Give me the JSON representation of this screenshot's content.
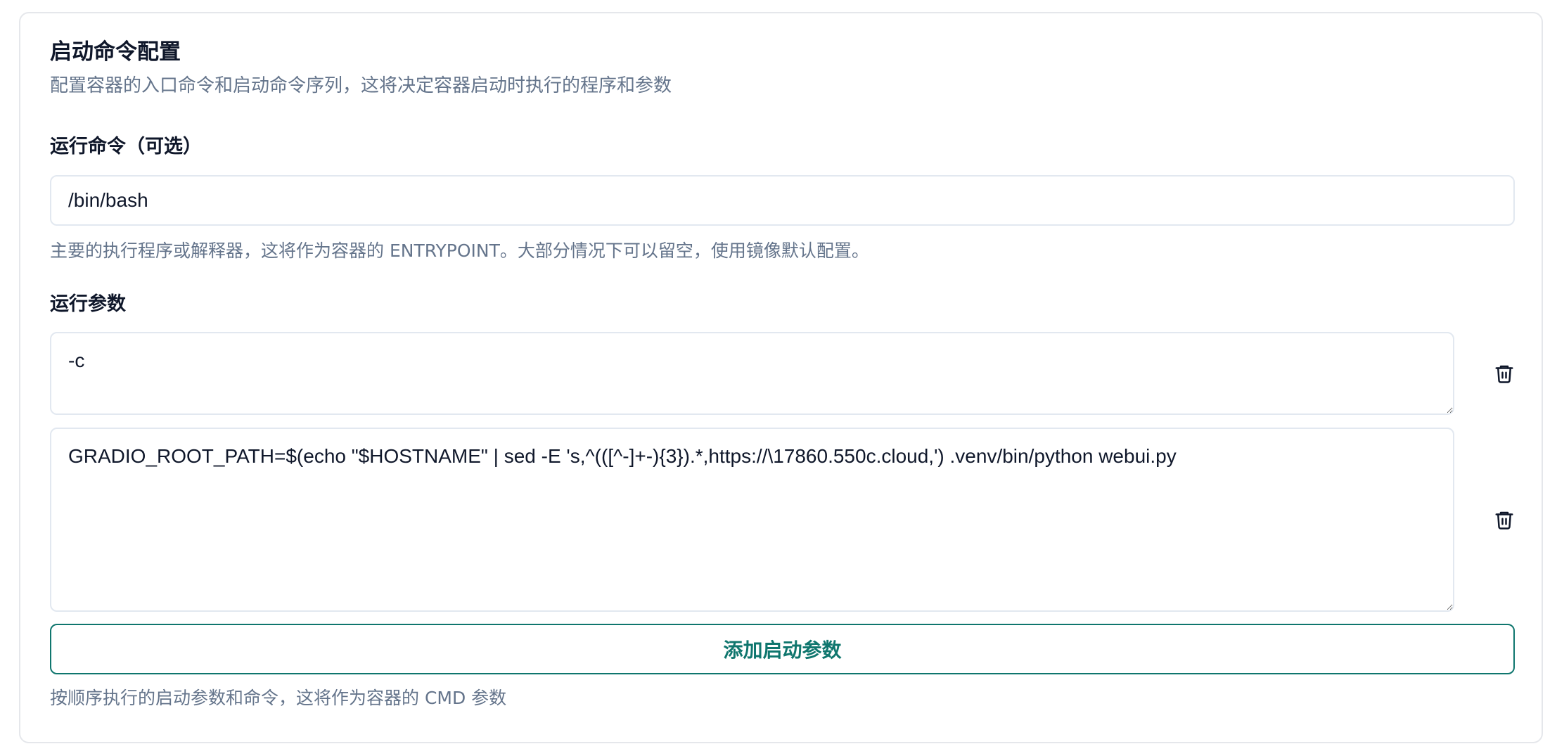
{
  "section": {
    "title": "启动命令配置",
    "description": "配置容器的入口命令和启动命令序列，这将决定容器启动时执行的程序和参数"
  },
  "command": {
    "label": "运行命令（可选）",
    "value": "/bin/bash",
    "hint": "主要的执行程序或解释器，这将作为容器的 ENTRYPOINT。大部分情况下可以留空，使用镜像默认配置。"
  },
  "args": {
    "label": "运行参数",
    "items": [
      {
        "value": "-c"
      },
      {
        "value": "GRADIO_ROOT_PATH=$(echo \"$HOSTNAME\" | sed -E 's,^(([^-]+-){3}).*,https://\\17860.550c.cloud,') .venv/bin/python webui.py"
      }
    ],
    "add_label": "添加启动参数",
    "hint": "按顺序执行的启动参数和命令，这将作为容器的 CMD 参数",
    "delete_icon": "trash-icon"
  },
  "colors": {
    "accent": "#0f766e",
    "muted_text": "#64748b",
    "border": "#e2e8f0"
  }
}
